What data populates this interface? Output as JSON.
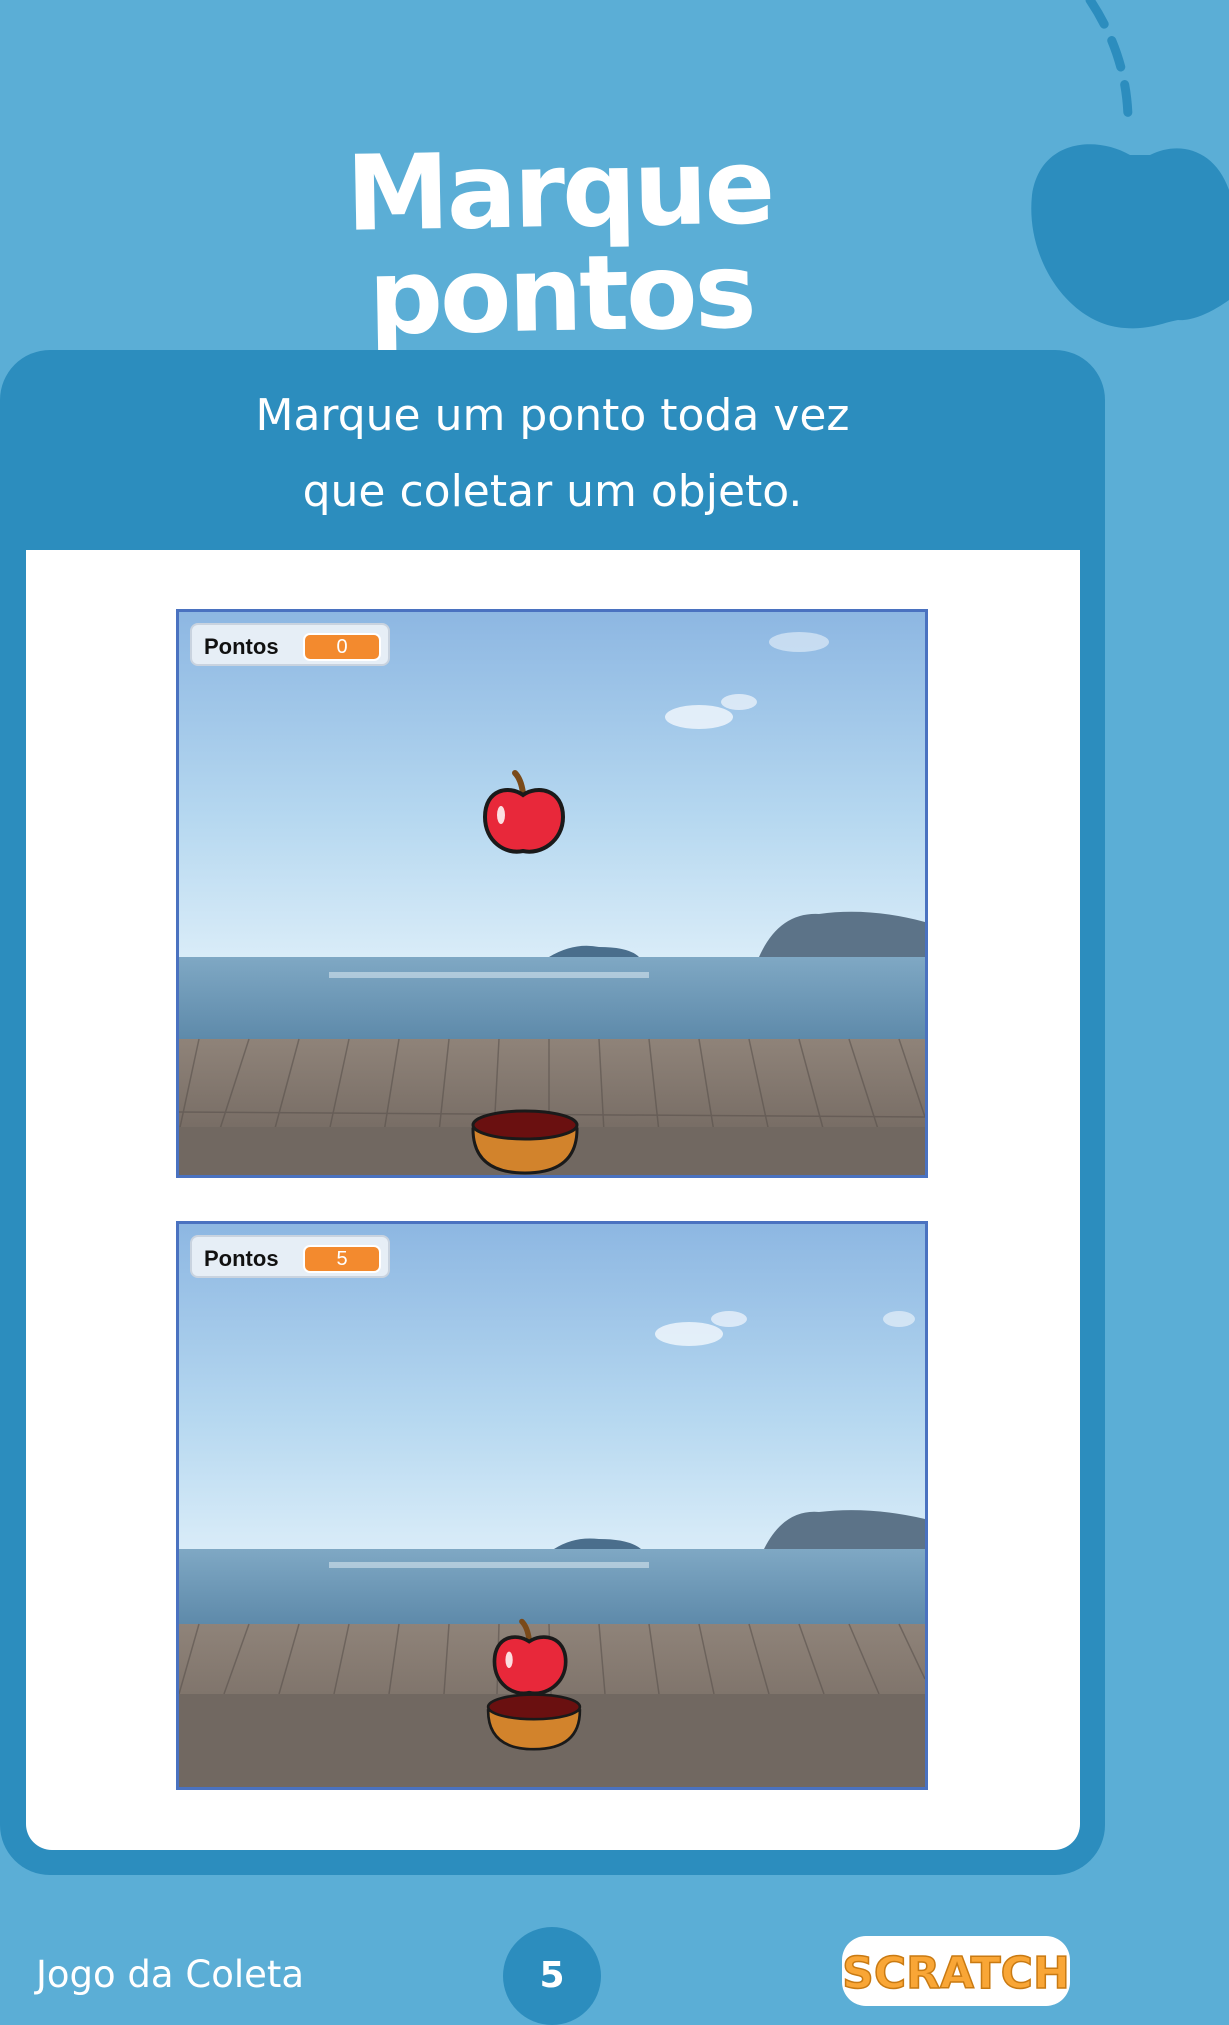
{
  "title": "Marque pontos",
  "card": {
    "caption_line1": "Marque um ponto toda vez",
    "caption_line2": "que coletar um objeto."
  },
  "stages": [
    {
      "score_label": "Pontos",
      "score_value": "0"
    },
    {
      "score_label": "Pontos",
      "score_value": "5"
    }
  ],
  "footer": {
    "title": "Jogo da Coleta",
    "page_number": "5",
    "logo_text": "SCRATCH"
  },
  "icons": {
    "decoration": "apple-icon",
    "sprite_fruit": "apple-icon",
    "sprite_bowl": "bowl-icon",
    "logo": "scratch-logo"
  },
  "colors": {
    "page_background": "#5BAED6",
    "card_background": "#2C8DBE",
    "score_badge": "#F38A2E",
    "stage_border": "#4A72C0",
    "logo_orange": "#F9A636"
  }
}
